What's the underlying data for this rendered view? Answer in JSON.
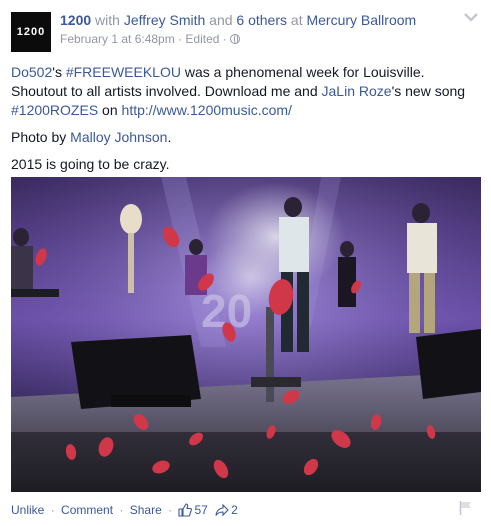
{
  "post": {
    "avatar_text": "1200",
    "author": "1200",
    "with_word": "with",
    "tagged_person": "Jeffrey Smith",
    "and_word": "and",
    "others": "6 others",
    "at_word": "at",
    "place": "Mercury Ballroom",
    "timestamp": "February 1 at 6:48pm",
    "edited": "Edited",
    "dot": "·",
    "body": {
      "p1_a": "Do502",
      "p1_b": "'s ",
      "p1_c": "#FREEWEEKLOU",
      "p1_d": " was a phenomenal week for Louisville. Shoutout to all artists involved. Download me and ",
      "p1_e": "JaLin Roze",
      "p1_f": "'s new song ",
      "p1_g": "#1200ROZES",
      "p1_h": " on ",
      "p1_i": "http://www.1200music.com/",
      "p2_a": "Photo by ",
      "p2_b": "Malloy Johnson",
      "p2_c": ".",
      "p3": "2015 is going to be crazy."
    }
  },
  "actions": {
    "unlike": "Unlike",
    "comment": "Comment",
    "share": "Share",
    "likes_count": "57",
    "shares_count": "2",
    "sep": "·"
  },
  "colors": {
    "link": "#3b5998",
    "muted": "#9197a3",
    "text": "#141823"
  },
  "icons": {
    "options": "chevron-down-icon",
    "privacy": "globe-icon",
    "like": "thumbs-up-icon",
    "share": "share-arrow-icon",
    "report": "flag-icon"
  }
}
